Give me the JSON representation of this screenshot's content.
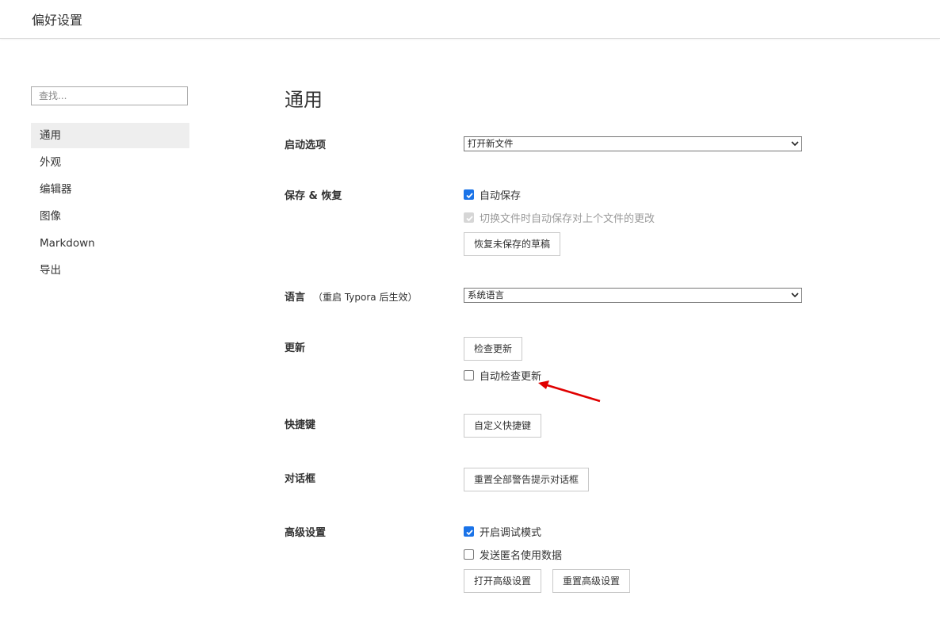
{
  "window": {
    "title": "偏好设置"
  },
  "sidebar": {
    "search_placeholder": "查找...",
    "items": [
      {
        "label": "通用",
        "active": true
      },
      {
        "label": "外观"
      },
      {
        "label": "编辑器"
      },
      {
        "label": "图像"
      },
      {
        "label": "Markdown"
      },
      {
        "label": "导出"
      }
    ]
  },
  "main": {
    "heading": "通用",
    "startup": {
      "label": "启动选项",
      "selected": "打开新文件"
    },
    "save": {
      "label": "保存 & 恢复",
      "autosave": "自动保存",
      "autosave_switch": "切换文件时自动保存对上个文件的更改",
      "recover_button": "恢复未保存的草稿"
    },
    "language": {
      "label": "语言",
      "note": "（重启 Typora 后生效）",
      "selected": "系统语言"
    },
    "update": {
      "label": "更新",
      "check_button": "检查更新",
      "auto_check": "自动检查更新"
    },
    "shortcuts": {
      "label": "快捷键",
      "button": "自定义快捷键"
    },
    "dialog": {
      "label": "对话框",
      "button": "重置全部警告提示对话框"
    },
    "advanced": {
      "label": "高级设置",
      "debug_mode": "开启调试模式",
      "send_usage": "发送匿名使用数据",
      "open_button": "打开高级设置",
      "reset_button": "重置高级设置"
    }
  },
  "colors": {
    "checkbox_accent": "#1a73e8",
    "annotation_arrow": "#e00000",
    "active_nav_bg": "#eeeeee"
  }
}
